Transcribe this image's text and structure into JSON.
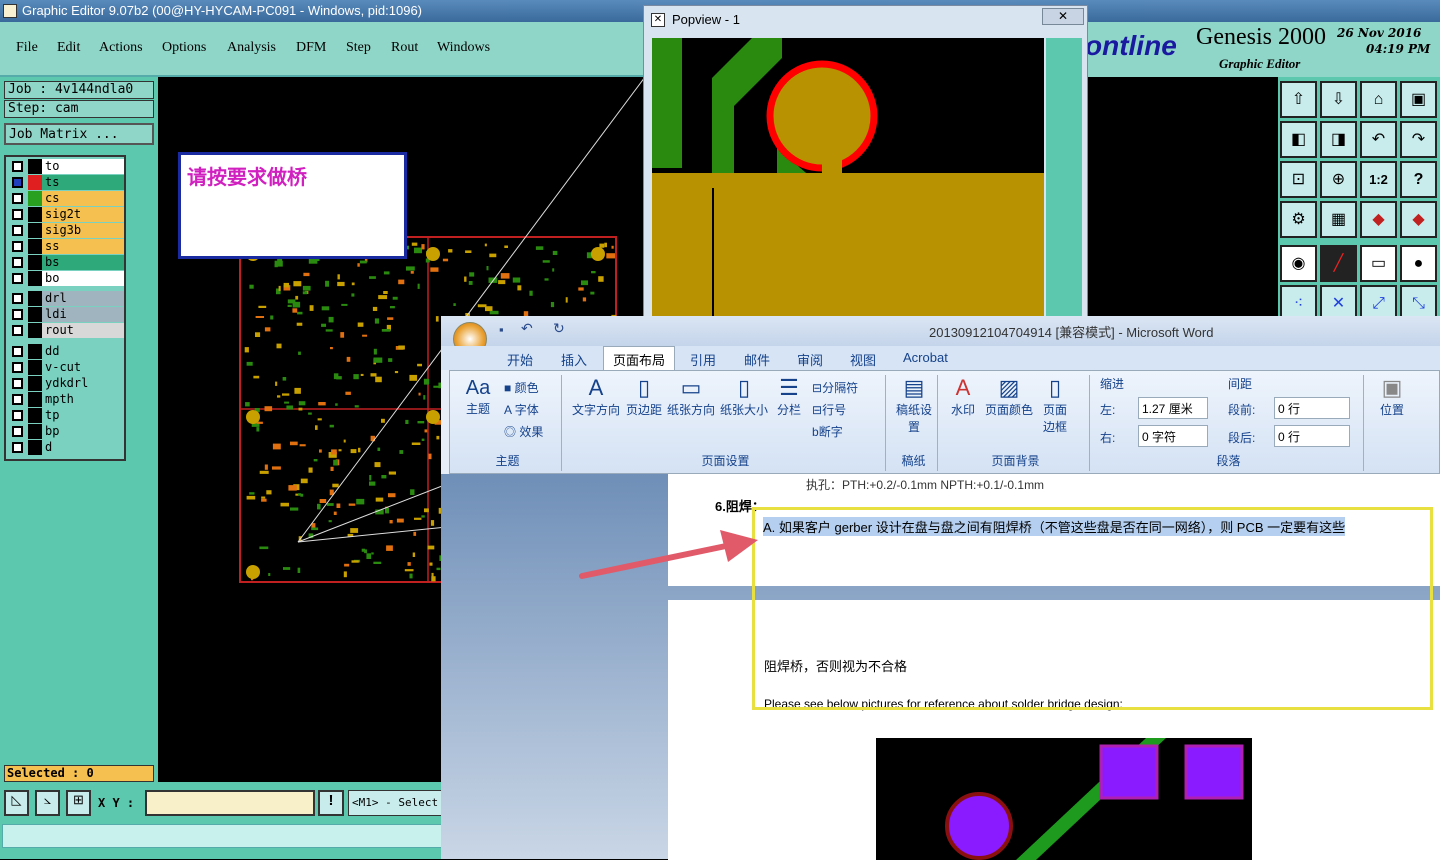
{
  "window": {
    "title": "Graphic Editor 9.07b2 (00@HY-HYCAM-PC091 - Windows, pid:1096)"
  },
  "menu": [
    "File",
    "Edit",
    "Actions",
    "Options",
    "Analysis",
    "DFM",
    "Step",
    "Rout",
    "Windows"
  ],
  "job": {
    "job_label": "Job : 4v144ndla0",
    "step_label": "Step: cam",
    "matrix_button": "Job Matrix ..."
  },
  "layers": [
    {
      "name": "to",
      "color": "#ffffff",
      "swatch": "#000000"
    },
    {
      "name": "ts",
      "color": "#2eaa7a",
      "swatch": "#e02020",
      "active": true
    },
    {
      "name": "cs",
      "color": "#f6c050",
      "swatch": "#2aa020"
    },
    {
      "name": "sig2t",
      "color": "#f6c050",
      "swatch": "#000000"
    },
    {
      "name": "sig3b",
      "color": "#f6c050",
      "swatch": "#000000"
    },
    {
      "name": "ss",
      "color": "#f6c050",
      "swatch": "#000000"
    },
    {
      "name": "bs",
      "color": "#2eaa7a",
      "swatch": "#000000"
    },
    {
      "name": "bo",
      "color": "#ffffff",
      "swatch": "#000000"
    },
    {
      "name": "drl",
      "color": "#a0b4c0",
      "swatch": "#000000"
    },
    {
      "name": "ldi",
      "color": "#a0b4c0",
      "swatch": "#000000"
    },
    {
      "name": "rout",
      "color": "#d8d8d8",
      "swatch": "#000000"
    },
    {
      "name": "dd",
      "color": "#7ad1c0",
      "swatch": "#000000"
    },
    {
      "name": "v-cut",
      "color": "#7ad1c0",
      "swatch": "#000000"
    },
    {
      "name": "ydkdrl",
      "color": "#7ad1c0",
      "swatch": "#000000"
    },
    {
      "name": "mpth",
      "color": "#7ad1c0",
      "swatch": "#000000"
    },
    {
      "name": "tp",
      "color": "#7ad1c0",
      "swatch": "#000000"
    },
    {
      "name": "bp",
      "color": "#7ad1c0",
      "swatch": "#000000"
    },
    {
      "name": "d",
      "color": "#7ad1c0",
      "swatch": "#000000"
    }
  ],
  "status": {
    "selected": "Selected : 0",
    "xy_label": "X Y :",
    "mode": "<M1> - Select"
  },
  "note": {
    "text": "请按要求做桥"
  },
  "genesis": {
    "brand": "ontline",
    "product": "Genesis 2000",
    "subtitle": "Graphic Editor",
    "date": "26 Nov 2016",
    "time": "04:19 PM"
  },
  "popview": {
    "title": "Popview - 1"
  },
  "word": {
    "title": "20130912104704914 [兼容模式] - Microsoft Word",
    "tabs": [
      "开始",
      "插入",
      "页面布局",
      "引用",
      "邮件",
      "审阅",
      "视图",
      "Acrobat"
    ],
    "groups": {
      "theme": {
        "label": "主题",
        "button": "主题",
        "colors": "颜色",
        "fonts": "字体",
        "effects": "效果"
      },
      "page_setup": {
        "label": "页面设置",
        "text_dir": "文字方向",
        "margins": "页边距",
        "orientation": "纸张方向",
        "size": "纸张大小",
        "columns": "分栏",
        "breaks": "分隔符",
        "line_numbers": "行号",
        "hyphenation": "断字"
      },
      "draft": {
        "label": "稿纸",
        "button": "稿纸设置"
      },
      "background": {
        "label": "页面背景",
        "watermark": "水印",
        "page_color": "页面颜色",
        "page_border": "页面边框"
      },
      "paragraph": {
        "label": "段落",
        "indent": "缩进",
        "spacing": "间距",
        "left": "左:",
        "left_val": "1.27 厘米",
        "right": "右:",
        "right_val": "0 字符",
        "before": "段前:",
        "before_val": "0 行",
        "after": "段后:",
        "after_val": "0 行"
      },
      "arrange": {
        "position": "位置"
      }
    },
    "doc": {
      "top_line": "执孔：PTH:+0.2/-0.1mm  NPTH:+0.1/-0.1mm",
      "section": "6.阻焊：",
      "para_a": "A. 如果客户 gerber 设计在盘与盘之间有阻焊桥（不管这些盘是否在同一网络），则 PCB 一定要有这些",
      "para_b": "阻焊桥，否则视为不合格",
      "para_c": "Please see below pictures for reference about solder bridge design:"
    }
  }
}
